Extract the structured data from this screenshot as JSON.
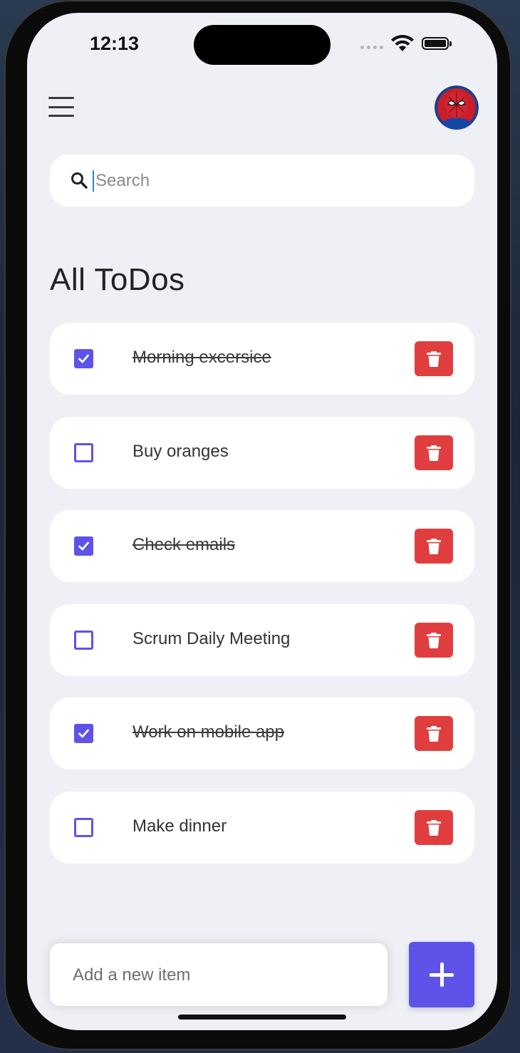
{
  "status_bar": {
    "time": "12:13",
    "icons": [
      "cellular-signal-icon",
      "wifi-icon",
      "battery-icon"
    ]
  },
  "header": {
    "menu_icon": "hamburger-menu-icon",
    "avatar_icon": "user-avatar"
  },
  "search": {
    "icon": "search-icon",
    "placeholder": "Search",
    "value": ""
  },
  "page_title": "All ToDos",
  "todos": [
    {
      "text": "Morning excersice",
      "done": true
    },
    {
      "text": "Buy oranges",
      "done": false
    },
    {
      "text": "Check emails",
      "done": true
    },
    {
      "text": "Scrum Daily Meeting",
      "done": false
    },
    {
      "text": "Work on mobile app",
      "done": true
    },
    {
      "text": "Make dinner",
      "done": false
    }
  ],
  "add_item": {
    "placeholder": "Add a new item",
    "value": "",
    "button_icon": "plus-icon"
  },
  "colors": {
    "accent": "#5f52e8",
    "delete": "#e03e3e",
    "background": "#eef0f5",
    "card": "#ffffff"
  }
}
